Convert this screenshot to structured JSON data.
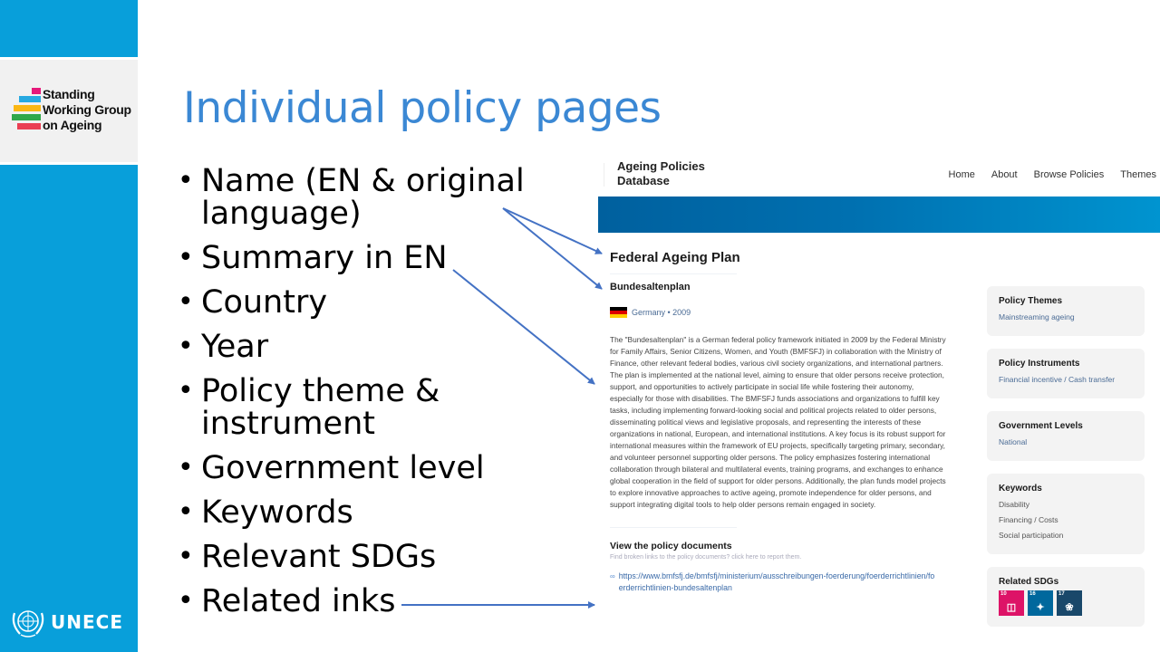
{
  "slide": {
    "title": "Individual policy pages",
    "bullets": [
      "Name (EN & original language)",
      "Summary in EN",
      "Country",
      "Year",
      "Policy theme & instrument",
      "Government level",
      "Keywords",
      "Relevant SDGs",
      "Related inks"
    ]
  },
  "sidebar": {
    "logo_text": [
      "Standing",
      "Working Group",
      "on Ageing"
    ],
    "logo_bar_colors": [
      "#e5197a",
      "#27a9e1",
      "#fbb714",
      "#30a84a",
      "#ea3f53"
    ],
    "footer_label": "UNECE",
    "accent_color": "#089fda"
  },
  "website": {
    "brand": [
      "Ageing Policies",
      "Database"
    ],
    "nav": [
      "Home",
      "About",
      "Browse Policies",
      "Themes"
    ],
    "policy": {
      "title": "Federal Ageing Plan",
      "original_name": "Bundesaltenplan",
      "country": "Germany",
      "year": "2009",
      "meta": "Germany • 2009",
      "summary": "The \"Bundesaltenplan\" is a German federal policy framework initiated in 2009 by the Federal Ministry for Family Affairs, Senior Citizens, Women, and Youth (BMFSFJ) in collaboration with the Ministry of Finance, other relevant federal bodies, various civil society organizations, and international partners. The plan is implemented at the national level, aiming to ensure that older persons receive protection, support, and opportunities to actively participate in social life while fostering their autonomy, especially for those with disabilities. The BMFSFJ funds associations and organizations to fulfill key tasks, including implementing forward-looking social and political projects related to older persons, disseminating political views and legislative proposals, and representing the interests of these organizations in national, European, and international institutions. A key focus is its robust support for international measures within the framework of EU projects, specifically targeting primary, secondary, and volunteer personnel supporting older persons. The policy emphasizes fostering international collaboration through bilateral and multilateral events, training programs, and exchanges to enhance global cooperation in the field of support for older persons. Additionally, the plan funds model projects to explore innovative approaches to active ageing, promote independence for older persons, and support integrating digital tools to help older persons remain engaged in society."
    },
    "documents": {
      "title": "View the policy documents",
      "subtitle": "Find broken links to the policy documents? click here to report them.",
      "link": "https://www.bmfsfj.de/bmfsfj/ministerium/ausschreibungen-foerderung/foerderrichtlinien/foerderrichtlinien-bundesaltenplan"
    },
    "cards": {
      "themes": {
        "title": "Policy Themes",
        "values": [
          "Mainstreaming ageing"
        ]
      },
      "instruments": {
        "title": "Policy Instruments",
        "values": [
          "Financial incentive / Cash transfer"
        ]
      },
      "levels": {
        "title": "Government Levels",
        "values": [
          "National"
        ]
      },
      "keywords": {
        "title": "Keywords",
        "values": [
          "Disability",
          "Financing / Costs",
          "Social participation"
        ]
      },
      "sdgs": {
        "title": "Related SDGs",
        "items": [
          {
            "number": "10",
            "icon": "reduced-inequalities-icon",
            "color": "#dd1367"
          },
          {
            "number": "16",
            "icon": "peace-justice-icon",
            "color": "#00689d"
          },
          {
            "number": "17",
            "icon": "partnerships-icon",
            "color": "#19486a"
          }
        ]
      }
    }
  }
}
